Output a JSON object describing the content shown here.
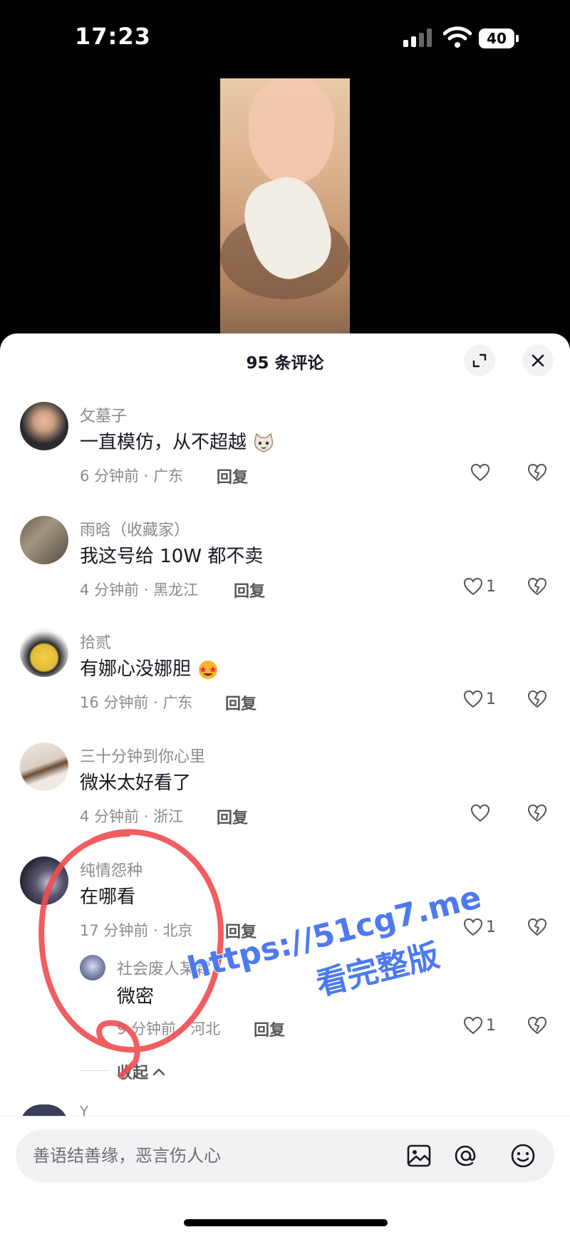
{
  "status": {
    "time": "17:23",
    "battery": "40"
  },
  "sheet": {
    "title": "95 条评论",
    "comments": [
      {
        "user": "攵墓子",
        "text": "一直模仿，从不超越",
        "time": "6 分钟前",
        "location": "广东",
        "reply": "回复",
        "likes": ""
      },
      {
        "user": "雨晗（收藏家）",
        "text": "我这号给 10W 都不卖",
        "time": "4 分钟前",
        "location": "黑龙江",
        "reply": "回复",
        "likes": "1"
      },
      {
        "user": "拾贰",
        "text": "有娜心没娜胆",
        "time": "16 分钟前",
        "location": "广东",
        "reply": "回复",
        "likes": "1"
      },
      {
        "user": "三十分钟到你心里",
        "text": "微米太好看了",
        "time": "4 分钟前",
        "location": "浙江",
        "reply": "回复",
        "likes": ""
      },
      {
        "user": "纯情怨种",
        "text": "在哪看",
        "time": "17 分钟前",
        "location": "北京",
        "reply": "回复",
        "likes": "1"
      }
    ],
    "sub_reply": {
      "user": "社会废人某霖",
      "text": "微密",
      "time": "9 分钟前",
      "location": "河北",
      "reply": "回复",
      "likes": "1"
    },
    "collapse_label": "收起",
    "next_user_partial": "Y"
  },
  "input": {
    "placeholder": "善语结善缘，恶言伤人心"
  },
  "watermark": {
    "line1": "https://51cg7.me",
    "line2": "看完整版"
  },
  "colors": {
    "watermark": "#4d7af0",
    "circle": "#ef4b4f"
  }
}
